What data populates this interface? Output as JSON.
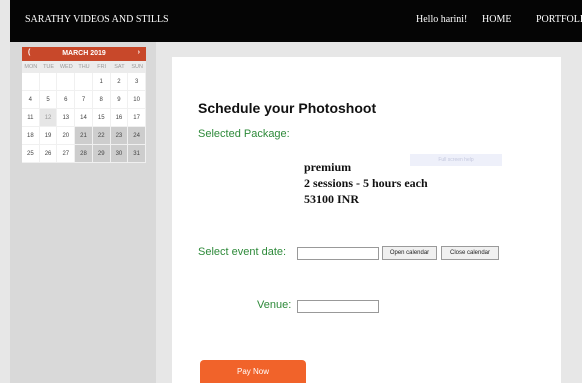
{
  "header": {
    "brand": "SARATHY VIDEOS AND STILLS",
    "greeting": "Hello harini!",
    "nav_home": "HOME",
    "nav_portfolio": "PORTFOLIO"
  },
  "calendar": {
    "prev": "(",
    "next": "›",
    "month": "MARCH 2019",
    "days_of_week": [
      "MON",
      "TUE",
      "WED",
      "THU",
      "FRI",
      "SAT",
      "SUN"
    ],
    "weeks": [
      [
        "",
        "",
        "",
        "",
        "1",
        "2",
        "3"
      ],
      [
        "4",
        "5",
        "6",
        "7",
        "8",
        "9",
        "10"
      ],
      [
        "11",
        "12",
        "13",
        "14",
        "15",
        "16",
        "17"
      ],
      [
        "18",
        "19",
        "20",
        "21",
        "22",
        "23",
        "24"
      ],
      [
        "25",
        "26",
        "27",
        "28",
        "29",
        "30",
        "31"
      ]
    ],
    "highlighted_day": "12",
    "accent_color": "#c8482a"
  },
  "form": {
    "title": "Schedule your Photoshoot",
    "selected_package_label": "Selected Package:",
    "package": {
      "name": "premium",
      "sessions": "2 sessions - 5 hours each",
      "price": "53100 INR"
    },
    "faint_text": "Full screen help",
    "event_date_label": "Select event date:",
    "event_date_value": "",
    "open_calendar": "Open calendar",
    "close_calendar": "Close calendar",
    "venue_label": "Venue:",
    "venue_value": "",
    "pay_button": "Pay Now",
    "label_color": "#2e8a3a",
    "pay_color": "#f1632a"
  }
}
